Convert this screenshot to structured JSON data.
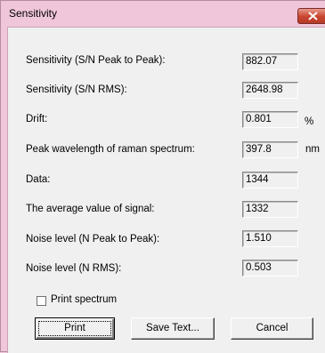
{
  "window": {
    "title": "Sensitivity"
  },
  "fields": [
    {
      "label": "Sensitivity (S/N Peak to Peak):",
      "value": "882.07",
      "unit": ""
    },
    {
      "label": "Sensitivity (S/N RMS):",
      "value": "2648.98",
      "unit": ""
    },
    {
      "label": "Drift:",
      "value": "0.801",
      "unit": "%"
    },
    {
      "label": "Peak wavelength of raman spectrum:",
      "value": "397.8",
      "unit": "nm"
    },
    {
      "label": "Data:",
      "value": "1344",
      "unit": ""
    },
    {
      "label": "The average value of signal:",
      "value": "1332",
      "unit": ""
    },
    {
      "label": "Noise level (N Peak to Peak):",
      "value": "1.510",
      "unit": ""
    },
    {
      "label": "Noise level (N RMS):",
      "value": "0.503",
      "unit": ""
    }
  ],
  "print_spectrum": {
    "label": "Print spectrum",
    "checked": false
  },
  "buttons": {
    "print": "Print",
    "save_text": "Save Text...",
    "cancel": "Cancel"
  }
}
